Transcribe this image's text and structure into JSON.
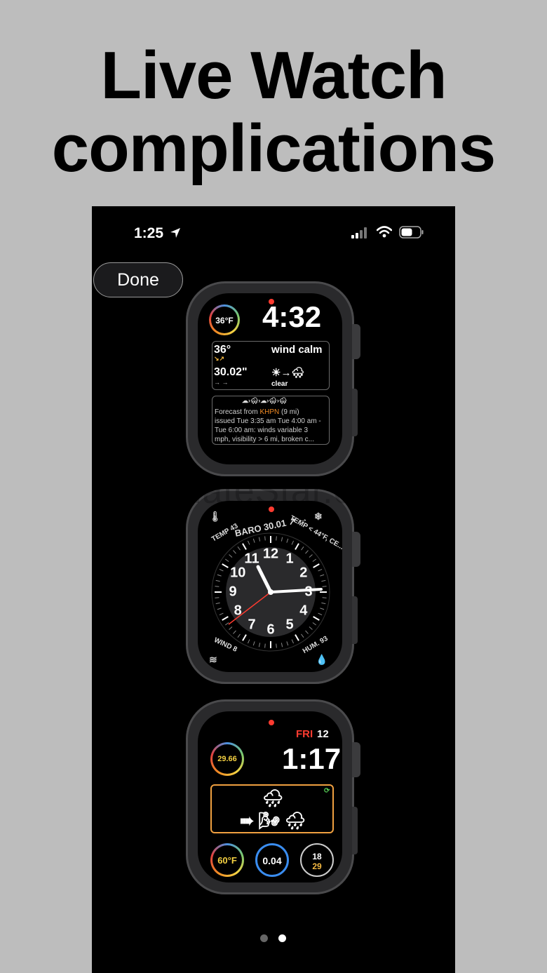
{
  "headline": {
    "line1": "Live Watch",
    "line2": "complications"
  },
  "status_bar": {
    "time": "1:25"
  },
  "done_button": {
    "label": "Done"
  },
  "watch1": {
    "temp_gauge": "36°F",
    "time": "4:32",
    "temp": "36°",
    "wind": "wind calm",
    "pressure": "30.02\"",
    "trend_arrows": "→ →",
    "condition": "clear",
    "forecast_icons": "☁›🌨›☁›🌨›🌨",
    "forecast_line1_prefix": "Forecast from ",
    "forecast_station": "KHPN",
    "forecast_line1_suffix": " (9 mi)",
    "forecast_line2": "issued Tue 3:35 am Tue 4:00 am -",
    "forecast_line3": "Tue 6:00 am: winds variable 3",
    "forecast_line4": "mph, visibility > 6 mi, broken c..."
  },
  "watch2": {
    "ring_left": "TEMP 43",
    "ring_baro": "BARO 30.01 ↗ →",
    "ring_right": "TEMP < 44°F, CE...",
    "wind_label": "WIND 8",
    "hum_label": "HUM. 93",
    "numbers": [
      "12",
      "1",
      "2",
      "3",
      "4",
      "5",
      "6",
      "7",
      "8",
      "9",
      "10",
      "11"
    ]
  },
  "watch3": {
    "day": "FRI",
    "date": "12",
    "time": "1:17",
    "baro_gauge": "29.66",
    "weather_top": "🌧",
    "weather_bottom": "➠ 🌬 🌧",
    "temp_gauge": "60°F",
    "precip": "0.04",
    "moon_top": "18",
    "moon_bottom": "29"
  },
  "watermark": "UpdateStar.com",
  "colors": {
    "accent_red": "#ff3b30",
    "orange_box": "#f0a040",
    "precip_blue": "#3a8df0"
  }
}
